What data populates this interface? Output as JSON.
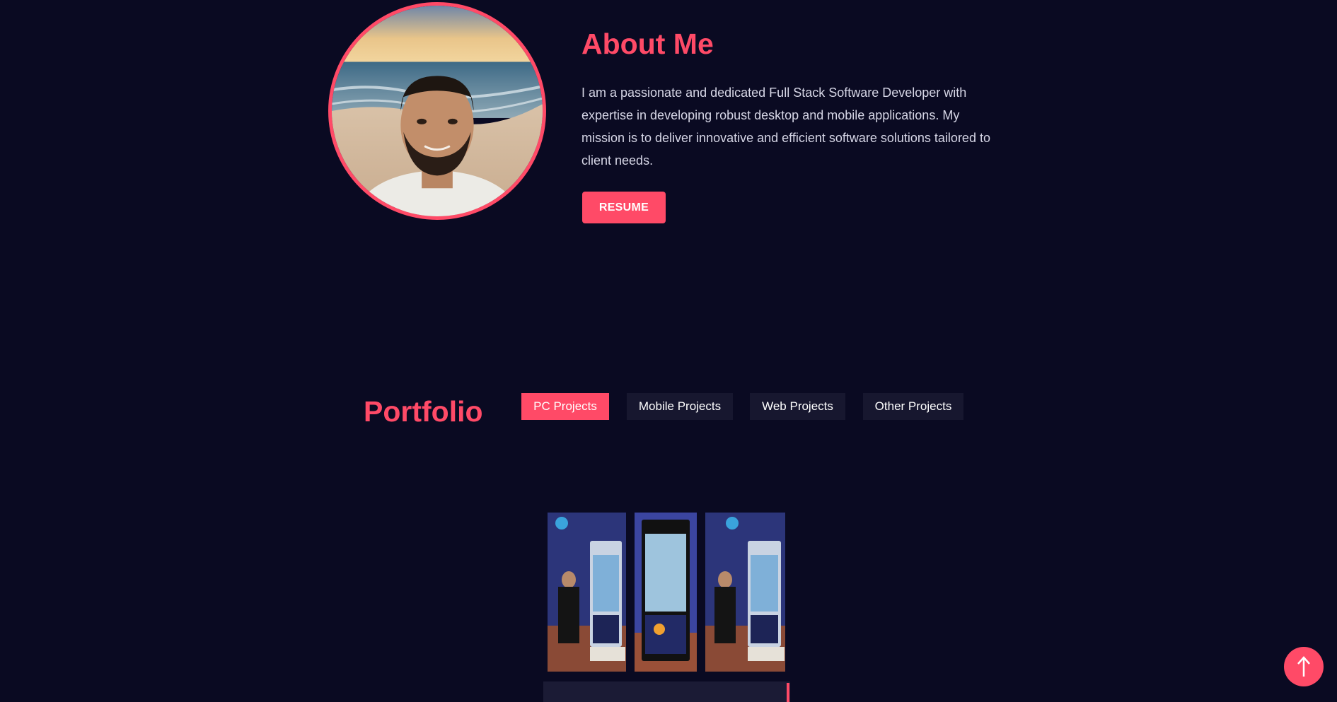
{
  "about": {
    "title": "About Me",
    "description": "I am a passionate and dedicated Full Stack Software Developer with expertise in developing robust desktop and mobile applications. My mission is to deliver innovative and efficient software solutions tailored to client needs.",
    "resume_label": "RESUME"
  },
  "portfolio": {
    "title": "Portfolio",
    "tabs": [
      {
        "label": "PC Projects",
        "active": true
      },
      {
        "label": "Mobile Projects",
        "active": false
      },
      {
        "label": "Web Projects",
        "active": false
      },
      {
        "label": "Other Projects",
        "active": false
      }
    ]
  },
  "colors": {
    "background": "#0a0a22",
    "accent": "#ff4a67",
    "tab_inactive": "#17172f",
    "text": "#d6d6e6"
  },
  "icons": {
    "scroll_top": "arrow-up-icon"
  }
}
